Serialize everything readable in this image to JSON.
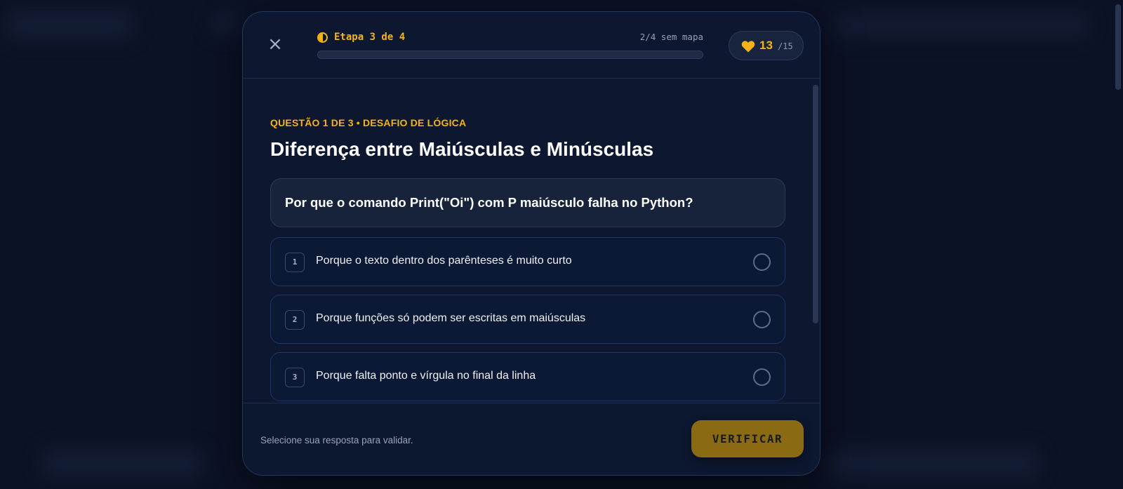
{
  "header": {
    "close_label": "×",
    "stage_label": "Etapa 3 de 4",
    "stage_map_label": "2/4 sem mapa",
    "progress_fraction": 0.0,
    "hearts_count": "13",
    "hearts_max": "/15",
    "icons": {
      "stage": "half-circle-icon",
      "hearts": "heart-icon",
      "close": "close-icon"
    }
  },
  "question": {
    "kicker": "QUESTÃO 1 DE 3 • DESAFIO DE LÓGICA",
    "title": "Diferença entre Maiúsculas e Minúsculas",
    "prompt": "Por que o comando Print(\"Oi\") com P maiúsculo falha no Python?",
    "options": [
      {
        "key": "1",
        "text": "Porque o texto dentro dos parênteses é muito curto"
      },
      {
        "key": "2",
        "text": "Porque funções só podem ser escritas em maiúsculas"
      },
      {
        "key": "3",
        "text": "Porque falta ponto e vírgula no final da linha"
      }
    ]
  },
  "footer": {
    "hint": "Selecione sua resposta para validar.",
    "verify_label": "VERIFICAR"
  },
  "colors": {
    "accent": "#f5b317",
    "background": "#0b1225",
    "modal": "#0d1830",
    "verify_button": "#8a6a12"
  }
}
